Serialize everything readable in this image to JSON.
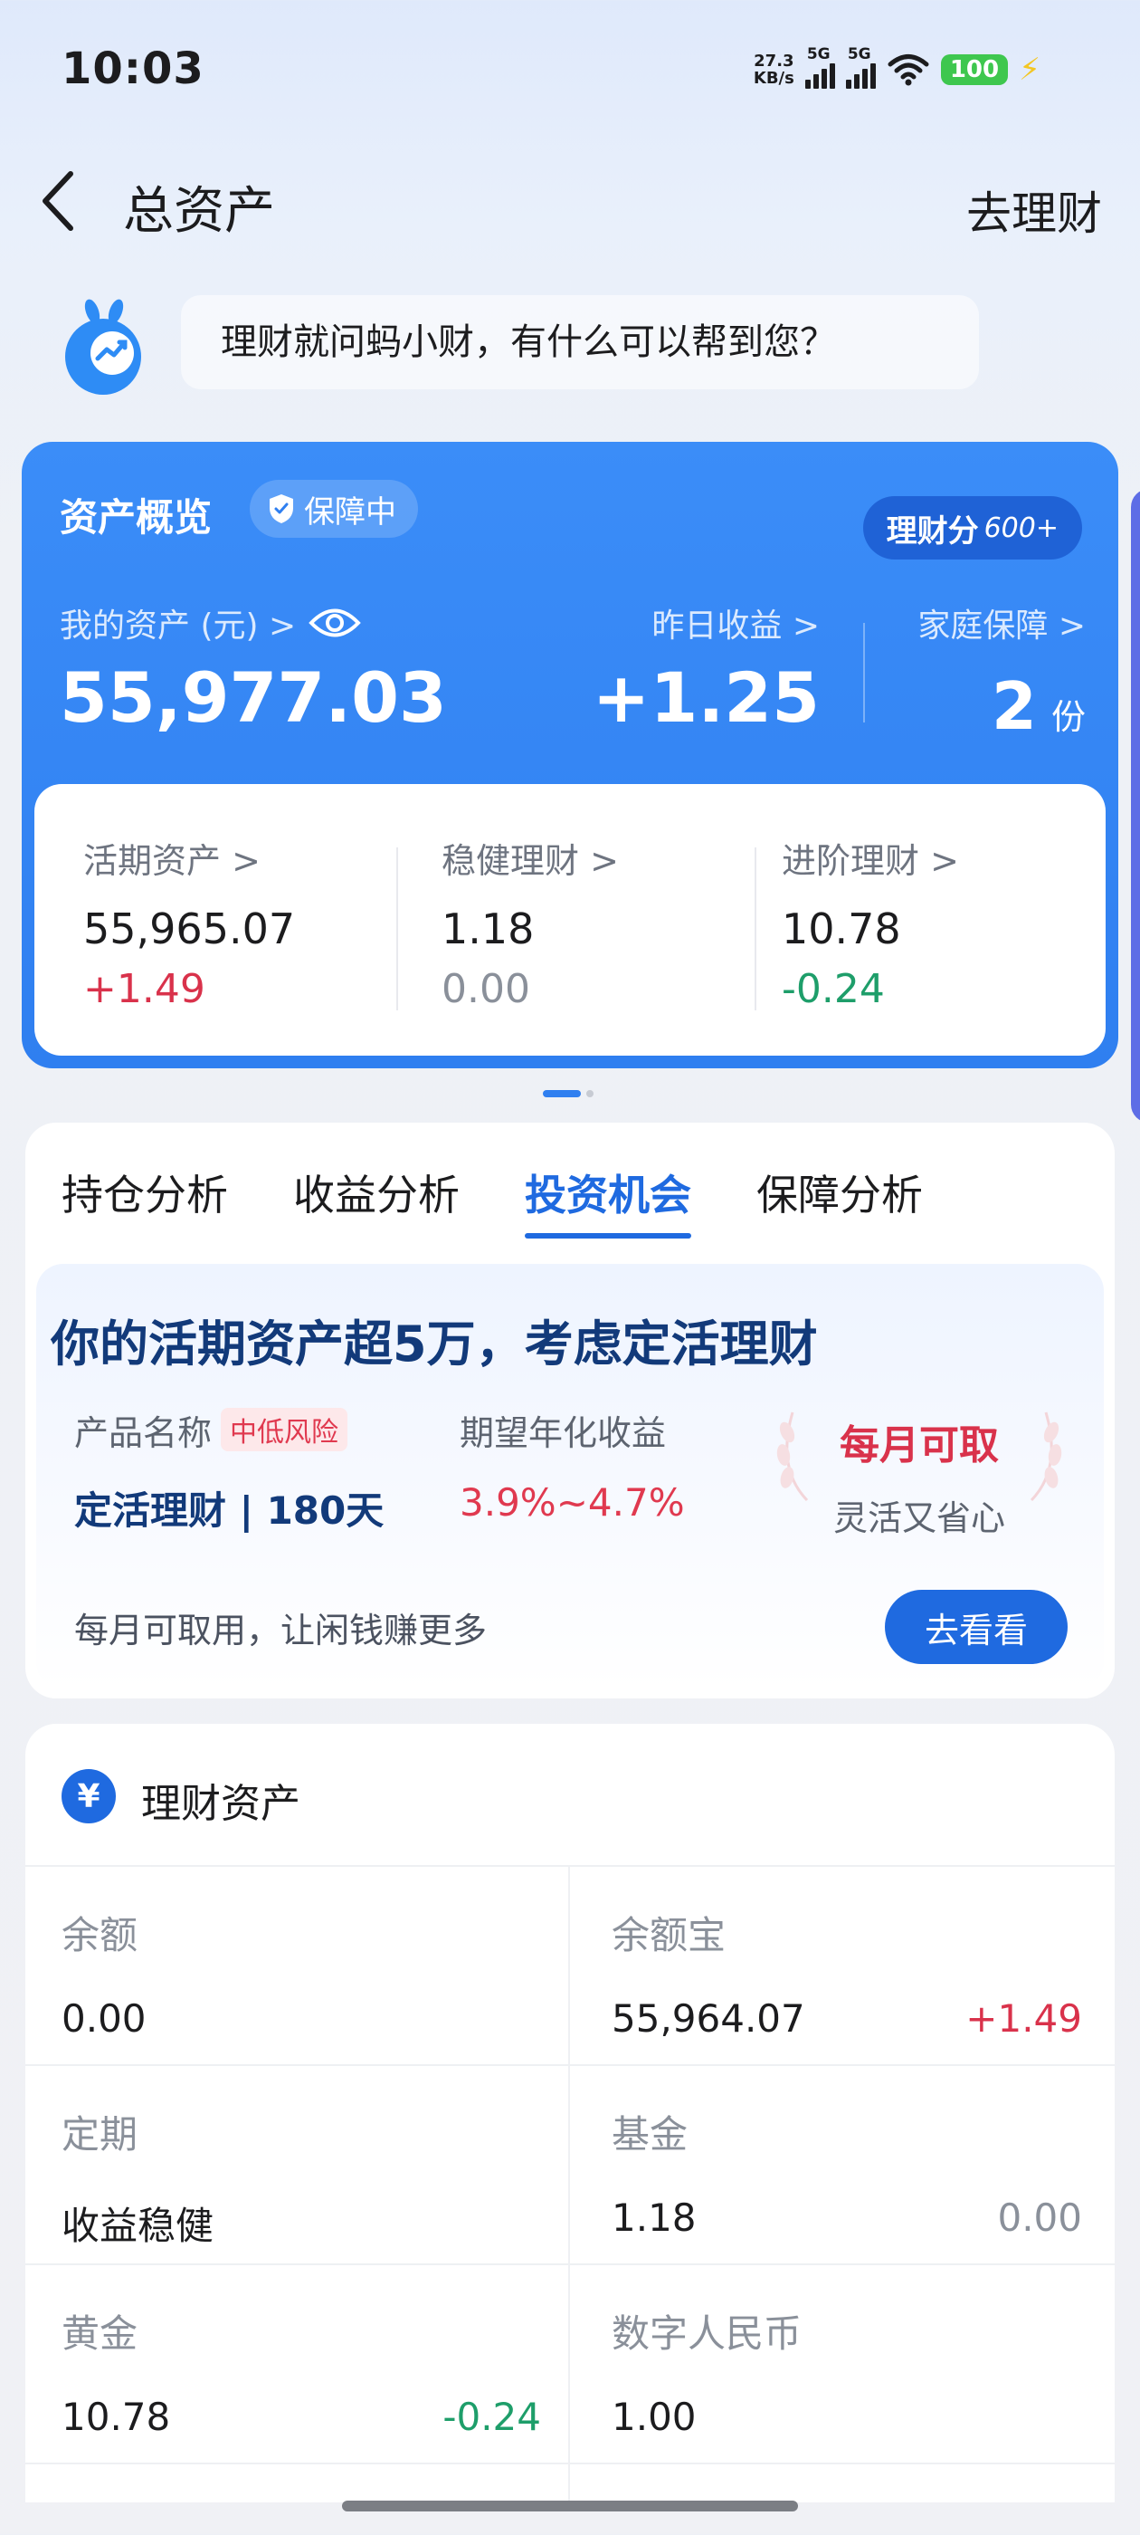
{
  "status_bar": {
    "time": "10:03",
    "net_speed_value": "27.3",
    "net_speed_unit": "KB/s",
    "signal1_label": "5G",
    "signal2_label": "5G",
    "battery": "100"
  },
  "header": {
    "title": "总资产",
    "action": "去理财"
  },
  "assistant": {
    "prompt": "理财就问蚂小财，有什么可以帮到您？"
  },
  "overview": {
    "title": "资产概览",
    "badge": "保障中",
    "score_label": "理财分",
    "score_value": "600+",
    "my_assets_label": "我的资产 (元) >",
    "my_assets_value": "55,977.03",
    "yesterday_label": "昨日收益 >",
    "yesterday_value": "+1.25",
    "family_label": "家庭保障 >",
    "family_value": "2",
    "family_unit": "份",
    "categories": [
      {
        "label": "活期资产 >",
        "value": "55,965.07",
        "change": "+1.49"
      },
      {
        "label": "稳健理财 >",
        "value": "1.18",
        "change": "0.00"
      },
      {
        "label": "进阶理财 >",
        "value": "10.78",
        "change": "-0.24"
      }
    ]
  },
  "tabs": [
    {
      "label": "持仓分析",
      "active": false
    },
    {
      "label": "收益分析",
      "active": false
    },
    {
      "label": "投资机会",
      "active": true
    },
    {
      "label": "保障分析",
      "active": false
    }
  ],
  "opportunity": {
    "headline": "你的活期资产超5万，考虑定活理财",
    "product_label": "产品名称",
    "risk_tag": "中低风险",
    "product_name": "定活理财 | 180天",
    "rate_label": "期望年化收益",
    "rate_value": "3.9%~4.7%",
    "feature_title": "每月可取",
    "feature_sub": "灵活又省心",
    "tip": "每月可取用，让闲钱赚更多",
    "button": "去看看"
  },
  "assets": {
    "title": "理财资产",
    "yen_symbol": "¥",
    "items": [
      {
        "label": "余额",
        "value": "0.00",
        "change": ""
      },
      {
        "label": "余额宝",
        "value": "55,964.07",
        "change": "+1.49"
      },
      {
        "label": "定期",
        "value": "收益稳健",
        "change": ""
      },
      {
        "label": "基金",
        "value": "1.18",
        "change": "0.00"
      },
      {
        "label": "黄金",
        "value": "10.78",
        "change": "-0.24"
      },
      {
        "label": "数字人民币",
        "value": "1.00",
        "change": ""
      }
    ]
  },
  "colors": {
    "accent_blue": "#1f6ae0",
    "gain_red": "#d9324b",
    "loss_green": "#1e9e6a",
    "neutral_gray": "#8a909a"
  }
}
